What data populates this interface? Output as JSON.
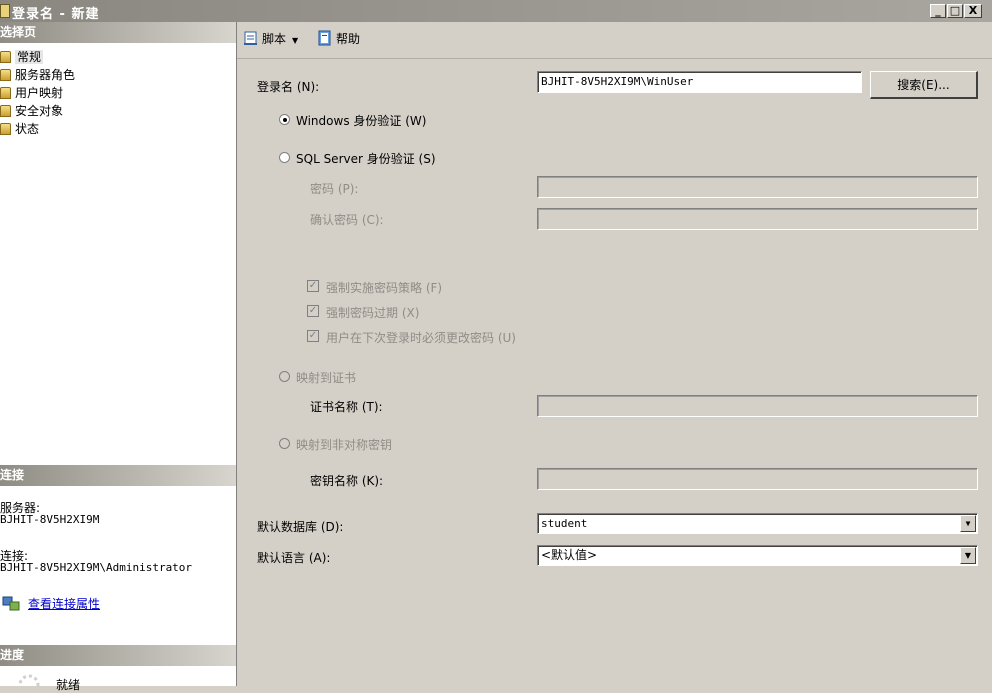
{
  "window": {
    "title": "登录名 - 新建",
    "controls": {
      "minimize": "_",
      "maximize": "□",
      "close": "X"
    }
  },
  "left": {
    "select_page_header": "选择页",
    "pages": [
      {
        "label": "常规",
        "icon": "page-icon"
      },
      {
        "label": "服务器角色",
        "icon": "page-icon"
      },
      {
        "label": "用户映射",
        "icon": "page-icon"
      },
      {
        "label": "安全对象",
        "icon": "page-icon"
      },
      {
        "label": "状态",
        "icon": "page-icon"
      }
    ],
    "connection_header": "连接",
    "server_label": "服务器:",
    "server_value": "BJHIT-8V5H2XI9M",
    "connection_label": "连接:",
    "connection_value": "BJHIT-8V5H2XI9M\\Administrator",
    "view_properties_link": "查看连接属性",
    "progress_header": "进度",
    "progress_status": "就绪"
  },
  "toolbar": {
    "script_label": "脚本",
    "help_label": "帮助"
  },
  "form": {
    "login_name_label": "登录名 (N):",
    "login_name_value": "BJHIT-8V5H2XI9M\\WinUser",
    "search_button": "搜索(E)...",
    "windows_auth_label": "Windows 身份验证 (W)",
    "windows_auth_selected": true,
    "sql_auth_label": "SQL Server 身份验证 (S)",
    "password_label": "密码 (P):",
    "confirm_password_label": "确认密码 (C):",
    "enforce_policy_label": "强制实施密码策略 (F)",
    "enforce_expiration_label": "强制密码过期 (X)",
    "must_change_label": "用户在下次登录时必须更改密码 (U)",
    "map_cert_label": "映射到证书",
    "cert_name_label": "证书名称 (T):",
    "map_asym_label": "映射到非对称密钥",
    "key_name_label": "密钥名称 (K):",
    "default_db_label": "默认数据库 (D):",
    "default_db_value": "student",
    "default_lang_label": "默认语言 (A):",
    "default_lang_value": "<默认值>"
  }
}
